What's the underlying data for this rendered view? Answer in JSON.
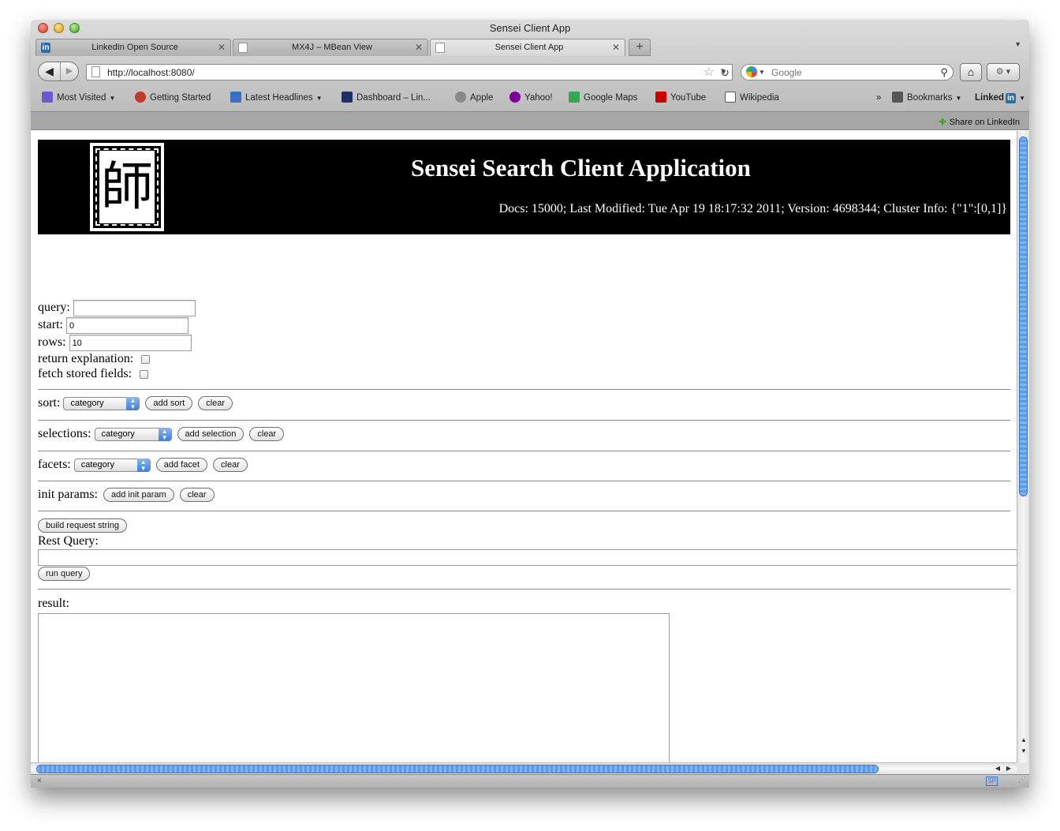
{
  "window": {
    "title": "Sensei Client App"
  },
  "tabs": [
    {
      "label": "LinkedIn Open Source",
      "icon": "linkedin-icon",
      "active": false
    },
    {
      "label": "MX4J – MBean View",
      "icon": "page-icon",
      "active": false
    },
    {
      "label": "Sensei Client App",
      "icon": "page-icon",
      "active": true
    }
  ],
  "tab_close_glyph": "✕",
  "newtab_glyph": "+",
  "nav": {
    "url": "http://localhost:8080/",
    "search_placeholder": "Google"
  },
  "bookmarks": [
    {
      "label": "Most Visited",
      "icon": "most-visited-icon",
      "dropdown": true,
      "color": "#6a5acd"
    },
    {
      "label": "Getting Started",
      "icon": "firefox-icon",
      "dropdown": false,
      "color": "#c0392b"
    },
    {
      "label": "Latest Headlines",
      "icon": "rss-icon",
      "dropdown": true,
      "color": "#3b6fc4"
    },
    {
      "label": "Dashboard – Lin...",
      "icon": "dashboard-icon",
      "dropdown": false,
      "color": "#1c2f66"
    },
    {
      "label": "Apple",
      "icon": "apple-icon",
      "dropdown": false,
      "color": "#888888"
    },
    {
      "label": "Yahoo!",
      "icon": "yahoo-icon",
      "dropdown": false,
      "color": "#7b0099"
    },
    {
      "label": "Google Maps",
      "icon": "google-maps-icon",
      "dropdown": false,
      "color": "#34a853"
    },
    {
      "label": "YouTube",
      "icon": "youtube-icon",
      "dropdown": false,
      "color": "#cc0000"
    },
    {
      "label": "Wikipedia",
      "icon": "wikipedia-icon",
      "dropdown": false,
      "color": "#555555"
    }
  ],
  "bookmarks_overflow": "»",
  "bookmarks_menu": "Bookmarks",
  "linkedin_toolbar": "Linked",
  "notify": {
    "share_label": "Share on LinkedIn"
  },
  "banner": {
    "logo_glyph": "師",
    "title": "Sensei Search Client Application",
    "info": "Docs: 15000; Last Modified: Tue Apr 19 18:17:32 2011; Version: 4698344; Cluster Info: {\"1\":[0,1]}"
  },
  "form": {
    "query_label": "query:",
    "query_value": "",
    "start_label": "start:",
    "start_value": "0",
    "rows_label": "rows:",
    "rows_value": "10",
    "explain_label": "return explanation:",
    "explain_checked": false,
    "fetch_label": "fetch stored fields:",
    "fetch_checked": false,
    "sort_label": "sort:",
    "sort_value": "category",
    "add_sort": "add sort",
    "selections_label": "selections:",
    "selections_value": "category",
    "add_selection": "add selection",
    "facets_label": "facets:",
    "facets_value": "category",
    "add_facet": "add facet",
    "init_label": "init params:",
    "add_init": "add init param",
    "clear": "clear",
    "build_request": "build request string",
    "rest_query_label": "Rest Query:",
    "rest_query_value": "",
    "run_query": "run query",
    "result_label": "result:",
    "result_value": ""
  },
  "status": {
    "close_glyph": "×",
    "sp_badge": "SP"
  },
  "colors": {
    "banner_bg": "#000000",
    "scroll_thumb": "#5e98e6",
    "notify_bg": "#a6a6a6"
  }
}
